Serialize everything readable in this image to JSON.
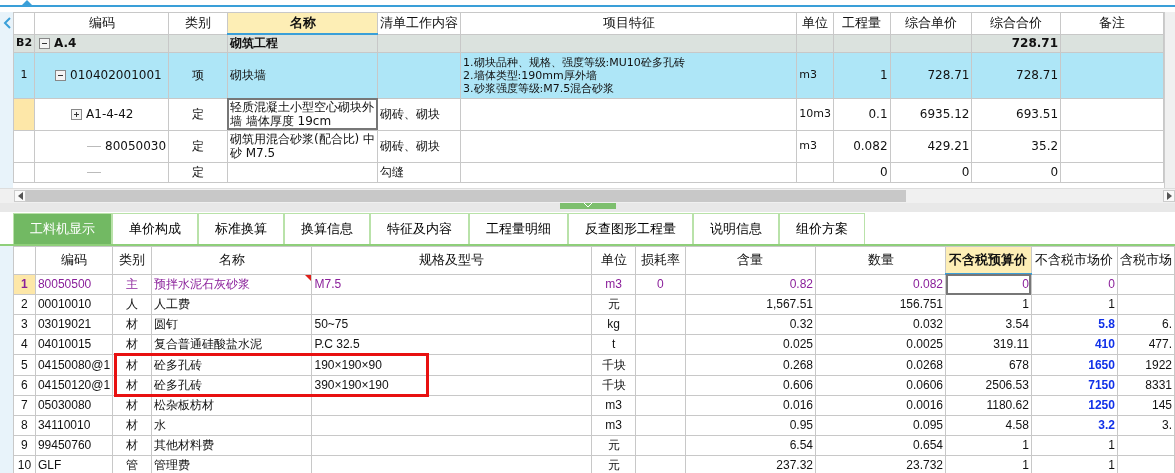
{
  "top_table": {
    "columns": [
      {
        "label": "编码",
        "sorted": false
      },
      {
        "label": "类别",
        "sorted": false
      },
      {
        "label": "名称",
        "sorted": true
      },
      {
        "label": "清单工作内容",
        "sorted": false
      },
      {
        "label": "项目特征",
        "sorted": false
      },
      {
        "label": "单位",
        "sorted": false
      },
      {
        "label": "工程量",
        "sorted": false
      },
      {
        "label": "综合单价",
        "sorted": false
      },
      {
        "label": "综合合价",
        "sorted": false
      },
      {
        "label": "备注",
        "sorted": false
      }
    ],
    "rows": [
      {
        "kind": "group",
        "row_label": "B2",
        "expanded": true,
        "selected": false,
        "current": false,
        "code": "A.4",
        "name": "砌筑工程",
        "total": "728.71",
        "children": [
          {
            "kind": "item",
            "row_label": "1",
            "expanded": true,
            "selected": true,
            "current": false,
            "code": "010402001001",
            "type": "项",
            "name": "砌块墙",
            "feature": [
              "1.砌块品种、规格、强度等级:MU10砼多孔砖",
              "2.墙体类型:190mm厚外墙",
              "3.砂浆强度等级:M7.5混合砂浆"
            ],
            "unit": "m3",
            "qty": "1",
            "unit_price": "728.71",
            "total": "728.71",
            "children": [
              {
                "kind": "quota",
                "expanded": false,
                "selected": false,
                "current": true,
                "code": "A1-4-42",
                "type": "定",
                "name": "轻质混凝土小型空心砌块外墙 墙体厚度 19cm",
                "content": "砌砖、砌块",
                "unit": "10m3",
                "qty": "0.1",
                "unit_price": "6935.12",
                "total": "693.51",
                "children": [
                  {
                    "kind": "material",
                    "selected": false,
                    "current": false,
                    "code": "80050030",
                    "type": "定",
                    "name": "砌筑用混合砂浆(配合比) 中砂 M7.5",
                    "content": "砌砖、砌块",
                    "unit": "m3",
                    "qty": "0.082",
                    "unit_price": "429.21",
                    "total": "35.2"
                  },
                  {
                    "kind": "material",
                    "selected": false,
                    "current": false,
                    "type": "定",
                    "content": "勾缝",
                    "qty": "0",
                    "unit_price": "0",
                    "total": "0"
                  }
                ]
              }
            ]
          }
        ]
      }
    ]
  },
  "tabs": [
    {
      "label": "工料机显示",
      "selected": true
    },
    {
      "label": "单价构成",
      "selected": false
    },
    {
      "label": "标准换算",
      "selected": false
    },
    {
      "label": "换算信息",
      "selected": false
    },
    {
      "label": "特征及内容",
      "selected": false
    },
    {
      "label": "工程量明细",
      "selected": false
    },
    {
      "label": "反查图形工程量",
      "selected": false
    },
    {
      "label": "说明信息",
      "selected": false
    },
    {
      "label": "组价方案",
      "selected": false
    }
  ],
  "bottom_table": {
    "columns": [
      {
        "label": "编码",
        "sorted": false
      },
      {
        "label": "类别",
        "sorted": false
      },
      {
        "label": "名称",
        "sorted": false
      },
      {
        "label": "规格及型号",
        "sorted": false
      },
      {
        "label": "单位",
        "sorted": false
      },
      {
        "label": "损耗率",
        "sorted": false
      },
      {
        "label": "含量",
        "sorted": false
      },
      {
        "label": "数量",
        "sorted": false
      },
      {
        "label": "不含税预算价",
        "sorted": true
      },
      {
        "label": "不含税市场价",
        "sorted": false
      },
      {
        "label": "含税市场",
        "sorted": false
      }
    ],
    "rows": [
      {
        "num": "1",
        "current": true,
        "main": true,
        "has_note": true,
        "adjusted": false,
        "code": "80050500",
        "type": "主",
        "name": "预拌水泥石灰砂浆",
        "spec": "M7.5",
        "unit": "m3",
        "loss": "0",
        "content": "0.82",
        "qty": "0.082",
        "budget": "0",
        "market": "0"
      },
      {
        "num": "2",
        "current": false,
        "main": false,
        "has_note": false,
        "adjusted": false,
        "code": "00010010",
        "type": "人",
        "name": "人工费",
        "unit": "元",
        "content": "1,567.51",
        "qty": "156.751",
        "budget": "1",
        "market": "1"
      },
      {
        "num": "3",
        "current": false,
        "main": false,
        "has_note": false,
        "adjusted": true,
        "code": "03019021",
        "type": "材",
        "name": "圆钉",
        "spec": "50~75",
        "unit": "kg",
        "content": "0.32",
        "qty": "0.032",
        "budget": "3.54",
        "market": "5.8",
        "market_tax": "6."
      },
      {
        "num": "4",
        "current": false,
        "main": false,
        "has_note": false,
        "adjusted": true,
        "code": "04010015",
        "type": "材",
        "name": "复合普通硅酸盐水泥",
        "spec": "P.C 32.5",
        "unit": "t",
        "content": "0.025",
        "qty": "0.0025",
        "budget": "319.11",
        "market": "410",
        "market_tax": "477."
      },
      {
        "num": "5",
        "current": false,
        "main": false,
        "has_note": false,
        "adjusted": true,
        "code": "04150080@1",
        "type": "材",
        "name": "砼多孔砖",
        "spec": "190×190×90",
        "unit": "千块",
        "content": "0.268",
        "qty": "0.0268",
        "budget": "678",
        "market": "1650",
        "market_tax": "1922",
        "highlighted": true
      },
      {
        "num": "6",
        "current": false,
        "main": false,
        "has_note": false,
        "adjusted": true,
        "code": "04150120@1",
        "type": "材",
        "name": "砼多孔砖",
        "spec": "390×190×190",
        "unit": "千块",
        "content": "0.606",
        "qty": "0.0606",
        "budget": "2506.53",
        "market": "7150",
        "market_tax": "8331",
        "highlighted": true
      },
      {
        "num": "7",
        "current": false,
        "main": false,
        "has_note": false,
        "adjusted": true,
        "code": "05030080",
        "type": "材",
        "name": "松杂板枋材",
        "unit": "m3",
        "content": "0.016",
        "qty": "0.0016",
        "budget": "1180.62",
        "market": "1250",
        "market_tax": "145"
      },
      {
        "num": "8",
        "current": false,
        "main": false,
        "has_note": false,
        "adjusted": true,
        "code": "34110010",
        "type": "材",
        "name": "水",
        "unit": "m3",
        "content": "0.95",
        "qty": "0.095",
        "budget": "4.58",
        "market": "3.2",
        "market_tax": "3."
      },
      {
        "num": "9",
        "current": false,
        "main": false,
        "has_note": false,
        "adjusted": false,
        "code": "99450760",
        "type": "材",
        "name": "其他材料费",
        "unit": "元",
        "content": "6.54",
        "qty": "0.654",
        "budget": "1",
        "market": "1"
      },
      {
        "num": "10",
        "current": false,
        "main": false,
        "has_note": false,
        "adjusted": false,
        "code": "GLF",
        "type": "管",
        "name": "管理费",
        "unit": "元",
        "content": "237.32",
        "qty": "23.732",
        "budget": "1",
        "market": "1"
      }
    ]
  }
}
